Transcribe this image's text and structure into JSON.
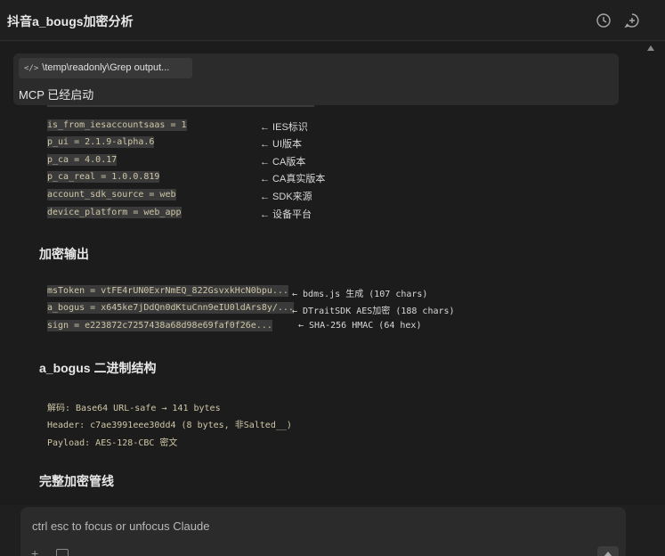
{
  "window": {
    "title": "抖音a_bougs加密分析"
  },
  "mcp": {
    "chip_label": "\\temp\\readonly\\Grep output...",
    "chip_icon": "</>",
    "status": "MCP 已经启动"
  },
  "params": [
    {
      "code": "is_from_iesaccountsaas = 1      ",
      "note": "← IES标识"
    },
    {
      "code": "p_ui = 2.1.9-alpha.6            ",
      "note": "← UI版本"
    },
    {
      "code": "p_ca = 4.0.17                   ",
      "note": "← CA版本"
    },
    {
      "code": "p_ca_real = 1.0.0.819           ",
      "note": "← CA真实版本"
    },
    {
      "code": "account_sdk_source = web        ",
      "note": "← SDK来源"
    },
    {
      "code": "device_platform = web_app       ",
      "note": "← 设备平台"
    }
  ],
  "section_output": {
    "heading": "加密输出",
    "lines": [
      {
        "code": "msToken = vtFE4rUN0ExrNmEQ_822GsvxkHcN0bpu...",
        "note": "← bdms.js 生成 (107 chars)"
      },
      {
        "code": "a_bogus = x645ke7jDdQn0dKtuCnn9eIU0ldArs8y/...",
        "note": "← DTraitSDK AES加密 (188 chars)"
      },
      {
        "code": "sign = e223872c7257438a68d98e69faf0f26e...",
        "note": "← SHA-256 HMAC (64 hex)"
      }
    ]
  },
  "section_structure": {
    "heading": "a_bogus 二进制结构",
    "lines": [
      "解码: Base64 URL-safe → 141 bytes",
      "Header: c7ae3991eee30dd4 (8 bytes, 非Salted__)",
      "Payload: AES-128-CBC 密文"
    ]
  },
  "section_pipeline": {
    "heading": "完整加密管线"
  },
  "composer": {
    "placeholder": "ctrl esc to focus or unfocus Claude"
  },
  "colors": {
    "background": "#1f1f1f",
    "highlight": "#3a3a3a",
    "code_text": "#cfc7a8"
  }
}
